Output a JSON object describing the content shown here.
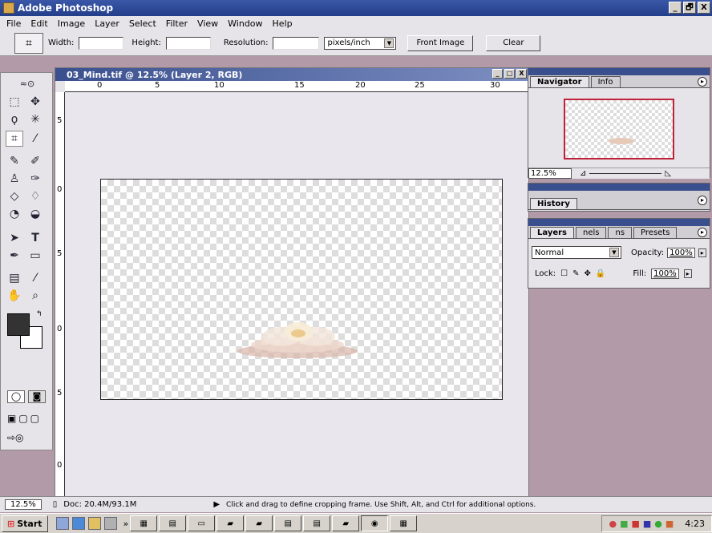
{
  "app": {
    "title": "Adobe Photoshop"
  },
  "window_buttons": [
    "_",
    "🗗",
    "X"
  ],
  "menu": [
    "File",
    "Edit",
    "Image",
    "Layer",
    "Select",
    "Filter",
    "View",
    "Window",
    "Help"
  ],
  "options": {
    "width_label": "Width:",
    "height_label": "Height:",
    "resolution_label": "Resolution:",
    "units": "pixels/inch",
    "front_image": "Front Image",
    "clear": "Clear"
  },
  "document": {
    "title": "03_Mind.tif @ 12.5% (Layer 2, RGB)",
    "ruler_h": [
      "0",
      "5",
      "10",
      "15",
      "20",
      "25",
      "30"
    ],
    "ruler_v": [
      "5",
      "0",
      "5",
      "0",
      "5",
      "0"
    ],
    "buttons": [
      "_",
      "□",
      "X"
    ]
  },
  "navigator": {
    "tabs": [
      "Navigator",
      "Info"
    ],
    "zoom": "12.5%"
  },
  "history": {
    "tab": "History"
  },
  "layers": {
    "tabs": [
      "Layers",
      "nels",
      "ns",
      "Presets"
    ],
    "blend": "Normal",
    "opacity_label": "Opacity:",
    "opacity": "100%",
    "lock_label": "Lock:",
    "fill_label": "Fill:",
    "fill": "100%"
  },
  "status": {
    "zoom": "12.5%",
    "doc": "Doc: 20.4M/93.1M",
    "hint": "Click and drag to define cropping frame. Use Shift, Alt, and Ctrl for additional options."
  },
  "taskbar": {
    "start": "Start",
    "chevron": "»",
    "clock": "4:23"
  }
}
